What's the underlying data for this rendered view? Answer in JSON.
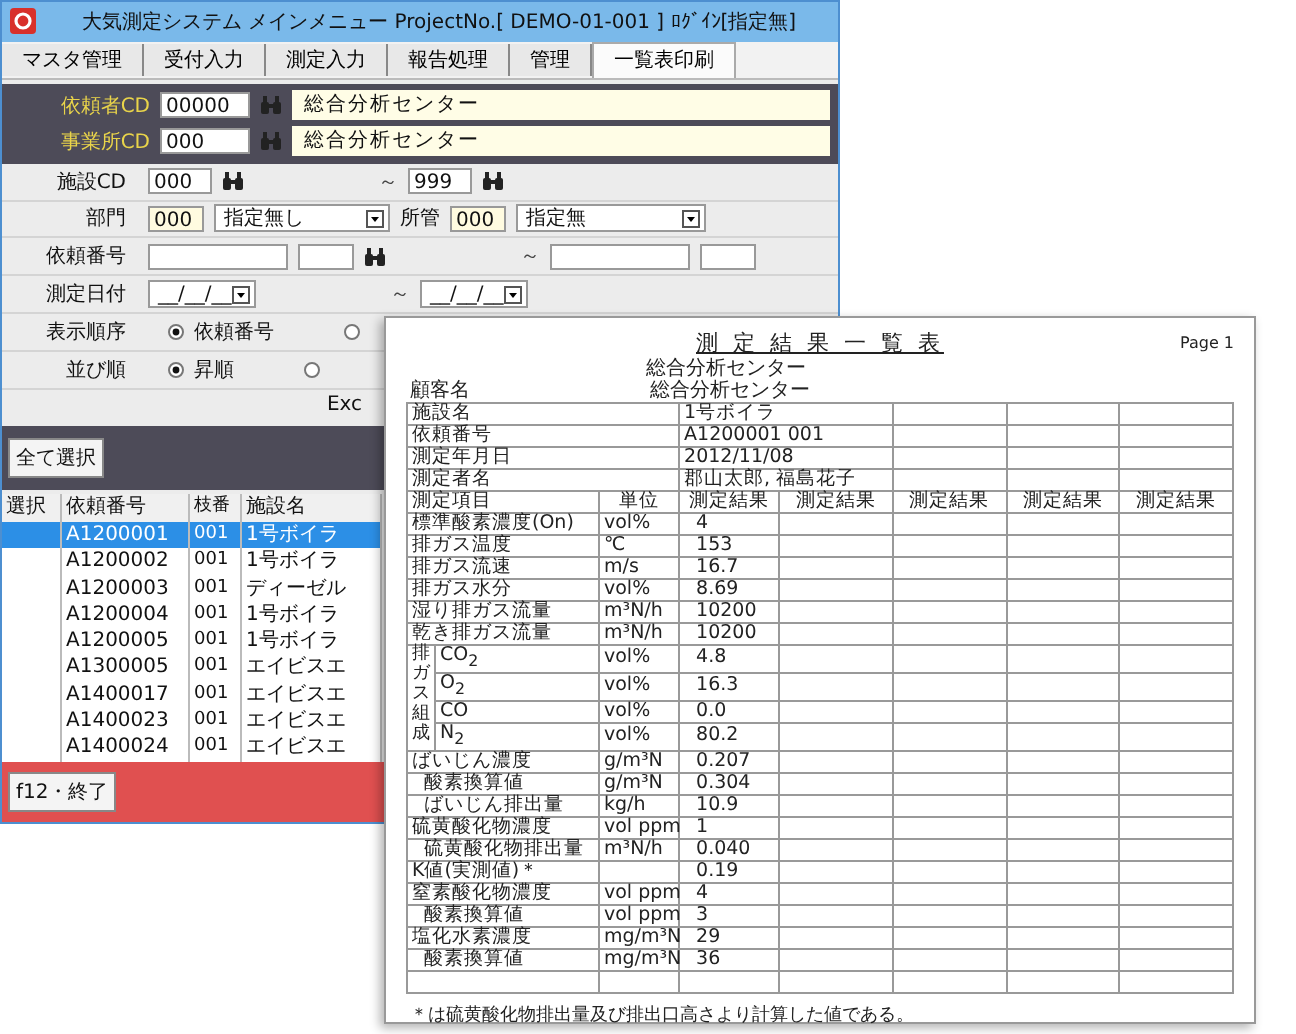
{
  "window": {
    "title": "大気測定システム メインメニュー ProjectNo.[ DEMO-01-001 ] ﾛｸﾞｲﾝ[指定無]"
  },
  "tabs": [
    {
      "label": "マスタ管理",
      "selected": false
    },
    {
      "label": "受付入力",
      "selected": false
    },
    {
      "label": "測定入力",
      "selected": false
    },
    {
      "label": "報告処理",
      "selected": false
    },
    {
      "label": "管理",
      "selected": false
    },
    {
      "label": "一覧表印刷",
      "selected": true
    }
  ],
  "header_fields": [
    {
      "label": "依頼者CD",
      "code": "00000",
      "name": "総合分析センター"
    },
    {
      "label": "事業所CD",
      "code": "000",
      "name": "総合分析センター"
    }
  ],
  "filters": [
    {
      "kind": "range",
      "label": "施設CD",
      "from": "000",
      "to": "999"
    },
    {
      "kind": "select",
      "label": "部門",
      "code": "000",
      "value": "指定無し",
      "label2": "所管",
      "code2": "000",
      "value2": "指定無"
    },
    {
      "kind": "range2",
      "label": "依頼番号",
      "separator": "～"
    },
    {
      "kind": "date",
      "label": "測定日付",
      "from": "__/__/__",
      "to": "__/__/__",
      "separator": "～"
    },
    {
      "kind": "radio",
      "label": "表示順序",
      "options": [
        {
          "label": "依頼番号",
          "selected": true
        },
        {
          "selected": false
        }
      ]
    },
    {
      "kind": "radio",
      "label": "並び順",
      "options": [
        {
          "label": "昇順",
          "selected": true
        },
        {
          "selected": false
        }
      ]
    }
  ],
  "range_separator": "～",
  "excel_label": "Exc",
  "select_all_button": "全て選択",
  "table": {
    "columns": [
      "選択",
      "依頼番号",
      "枝番",
      "施設名"
    ],
    "rows": [
      {
        "request_no": "A1200001",
        "branch": "001",
        "facility": "1号ボイラ",
        "selected": true
      },
      {
        "request_no": "A1200002",
        "branch": "001",
        "facility": "1号ボイラ",
        "selected": false
      },
      {
        "request_no": "A1200003",
        "branch": "001",
        "facility": "ディーゼル",
        "selected": false
      },
      {
        "request_no": "A1200004",
        "branch": "001",
        "facility": "1号ボイラ",
        "selected": false
      },
      {
        "request_no": "A1200005",
        "branch": "001",
        "facility": "1号ボイラ",
        "selected": false
      },
      {
        "request_no": "A1300005",
        "branch": "001",
        "facility": "エイビスエ",
        "selected": false
      },
      {
        "request_no": "A1400017",
        "branch": "001",
        "facility": "エイビスエ",
        "selected": false
      },
      {
        "request_no": "A1400023",
        "branch": "001",
        "facility": "エイビスエ",
        "selected": false
      },
      {
        "request_no": "A1400024",
        "branch": "001",
        "facility": "エイビスエ",
        "selected": false
      }
    ]
  },
  "footer_button": "f12・終了",
  "report": {
    "title": "測 定 結 果 一 覧 表",
    "page": "Page 1",
    "top_line": "総合分析センター",
    "customer": {
      "label": "顧客名",
      "value": "総合分析センター"
    },
    "info_rows": [
      {
        "label": "施設名",
        "value": "1号ボイラ"
      },
      {
        "label": "依頼番号",
        "value": "A1200001 001"
      },
      {
        "label": "測定年月日",
        "value": "2012/11/08"
      },
      {
        "label": "測定者名",
        "value": "郡山太郎, 福島花子"
      }
    ],
    "columns": [
      "測定項目",
      "単位",
      "測定結果",
      "測定結果",
      "測定結果",
      "測定結果",
      "測定結果"
    ],
    "rows": [
      {
        "kind": "item",
        "label": "標準酸素濃度(On)",
        "unit": "vol%",
        "value": "4"
      },
      {
        "kind": "item",
        "label": "排ガス温度",
        "unit": "℃",
        "value": "153"
      },
      {
        "kind": "item",
        "label": "排ガス流速",
        "unit": "m/s",
        "value": "16.7"
      },
      {
        "kind": "item",
        "label": "排ガス水分",
        "unit": "vol%",
        "value": "8.69"
      },
      {
        "kind": "item",
        "label": "湿り排ガス流量",
        "unit": "m³N/h",
        "value": "10200"
      },
      {
        "kind": "item",
        "label": "乾き排ガス流量",
        "unit": "m³N/h",
        "value": "10200"
      },
      {
        "kind": "group",
        "label": "排ガス組成",
        "children": [
          {
            "label": "CO$_{2}$",
            "unit": "vol%",
            "value": "4.8"
          },
          {
            "label": "O$_{2}$",
            "unit": "vol%",
            "value": "16.3"
          },
          {
            "label": "CO",
            "unit": "vol%",
            "value": "0.0"
          },
          {
            "label": "N$_{2}$",
            "unit": "vol%",
            "value": "80.2"
          }
        ]
      },
      {
        "kind": "item",
        "label": "ばいじん濃度",
        "unit": "g/m³N",
        "value": "0.207"
      },
      {
        "kind": "sub",
        "label": "酸素換算値",
        "unit": "g/m³N",
        "value": "0.304"
      },
      {
        "kind": "sub",
        "label": "ばいじん排出量",
        "unit": "kg/h",
        "value": "10.9"
      },
      {
        "kind": "item",
        "label": "硫黄酸化物濃度",
        "unit": "vol ppm",
        "value": "1"
      },
      {
        "kind": "sub",
        "label": "硫黄酸化物排出量",
        "unit": "m³N/h",
        "value": "0.040"
      },
      {
        "kind": "item",
        "label": "K値(実測値)＊",
        "value": "0.19"
      },
      {
        "kind": "item",
        "label": "窒素酸化物濃度",
        "unit": "vol ppm",
        "value": "4"
      },
      {
        "kind": "sub",
        "label": "酸素換算値",
        "unit": "vol ppm",
        "value": "3"
      },
      {
        "kind": "item",
        "label": "塩化水素濃度",
        "unit": "mg/m³N",
        "value": "29"
      },
      {
        "kind": "sub",
        "label": "酸素換算値",
        "unit": "mg/m³N",
        "value": "36"
      }
    ],
    "note": "＊は硫黄酸化物排出量及び排出口高さより計算した値である。"
  }
}
